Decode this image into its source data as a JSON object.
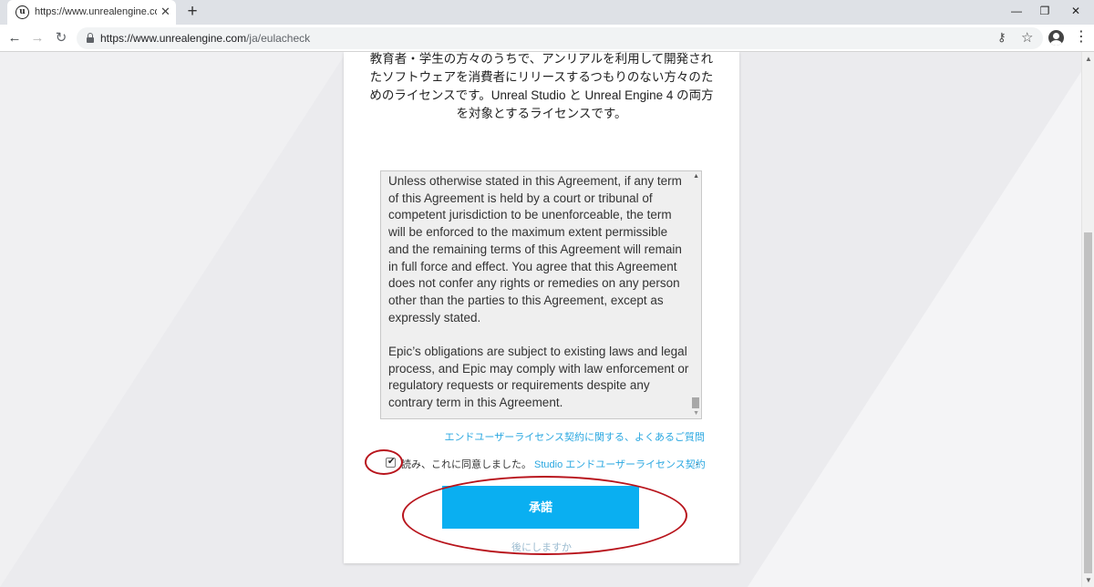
{
  "browser": {
    "tab_title": "https://www.unrealengine.com/ja",
    "tab_close": "✕",
    "new_tab": "+",
    "url_host": "https://www.unrealengine.com",
    "url_path": "/ja/eulacheck",
    "icons": [
      "unreal-favicon",
      "back-arrow-icon",
      "forward-arrow-icon",
      "reload-icon",
      "lock-icon",
      "key-icon",
      "star-icon",
      "account-icon",
      "menu-icon"
    ]
  },
  "page": {
    "intro_text": "アーキテクチャ・自動車・製造・デザイン ビジュアライゼーション・リニア エンターテイメントの仕事に携わっている方々・教育者・学生の方々のうちで、アンリアルを利用して開発されたソフトウェアを消費者にリリースするつもりのない方々のためのライセンスです。Unreal Studio と Unreal Engine 4 の両方を対象とするライセンスです。",
    "eula_text": "Unless otherwise stated in this Agreement, if any term of this Agreement is held by a court or tribunal of competent jurisdiction to be unenforceable, the term will be enforced to the maximum extent permissible and the remaining terms of this Agreement will remain in full force and effect. You agree that this Agreement does not confer any rights or remedies on any person other than the parties to this Agreement, except as expressly stated.\n\nEpic’s obligations are subject to existing laws and legal process, and Epic may comply with law enforcement or regulatory requests or requirements despite any contrary term in this Agreement.",
    "faq_link": "エンドユーザーライセンス契約に関する、よくあるご質問",
    "agree_text": "読み、これに同意しました。",
    "agree_link": "Studio エンドユーザーライセンス契約",
    "agree_period": ".",
    "agree_checked": true,
    "accept_button": "承諾",
    "later_link": "後にしますか"
  },
  "colors": {
    "accent": "#0aaff1",
    "link": "#2aa7e0",
    "annotation": "#b8141c"
  }
}
